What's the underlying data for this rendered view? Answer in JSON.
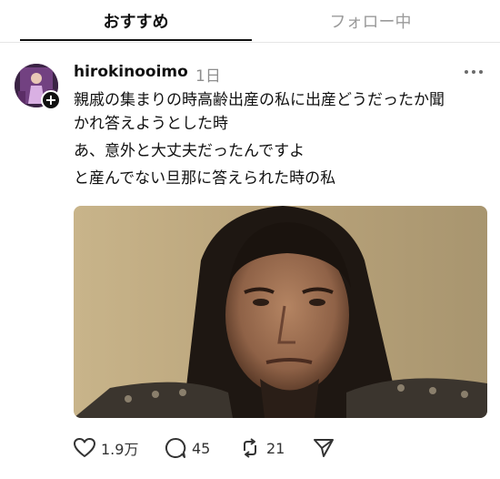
{
  "tabs": {
    "recommended": "おすすめ",
    "following": "フォロー中"
  },
  "post": {
    "username": "hirokinooimo",
    "time": "1日",
    "lines": [
      "親戚の集まりの時高齢出産の私に出産どうだったか聞",
      "かれ答えようとした時",
      "あ、意外と大丈夫だったんですよ",
      "と産んでない旦那に答えられた時の私"
    ],
    "likes": "1.9万",
    "replies": "45",
    "reposts": "21"
  },
  "icons": {
    "more": "more-dots-icon",
    "like": "heart-icon",
    "reply": "comment-icon",
    "repost": "repost-icon",
    "share": "send-icon",
    "follow": "plus-icon"
  }
}
